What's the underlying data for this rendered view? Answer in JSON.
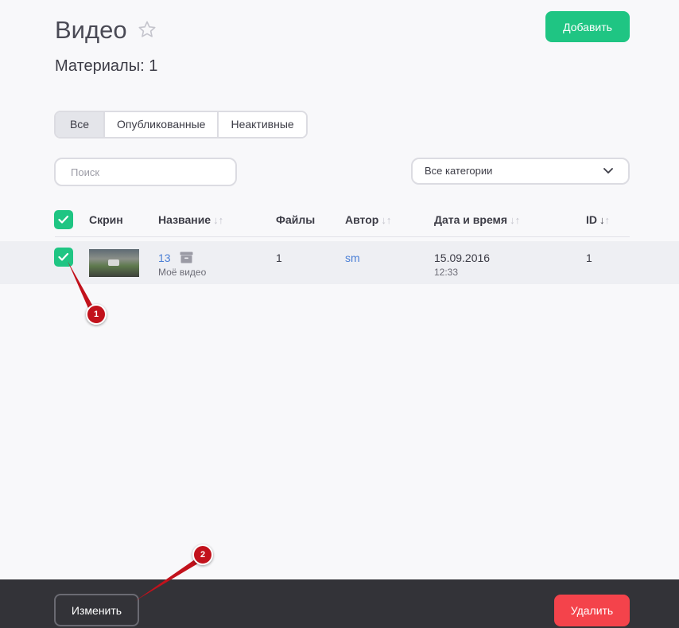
{
  "header": {
    "title": "Видео",
    "add_label": "Добавить",
    "materials": "Материалы: 1"
  },
  "tabs": [
    {
      "label": "Все",
      "active": true
    },
    {
      "label": "Опубликованные",
      "active": false
    },
    {
      "label": "Неактивные",
      "active": false
    }
  ],
  "filters": {
    "search_placeholder": "Поиск",
    "category_value": "Все категории"
  },
  "table": {
    "columns": [
      "Скрин",
      "Название",
      "Файлы",
      "Автор",
      "Дата и время",
      "ID"
    ],
    "rows": [
      {
        "checked": true,
        "title_link": "13",
        "title_sub": "Моё видео",
        "files": "1",
        "author": "sm",
        "date": "15.09.2016",
        "time": "12:33",
        "id": "1"
      }
    ]
  },
  "footer": {
    "edit_label": "Изменить",
    "delete_label": "Удалить"
  },
  "annotations": [
    {
      "label": "1"
    },
    {
      "label": "2"
    }
  ],
  "colors": {
    "accent_green": "#1fc583",
    "danger_red": "#f4434b",
    "link_blue": "#4b7fd6",
    "marker_red": "#c2121c",
    "bottom_bar": "#333338"
  }
}
